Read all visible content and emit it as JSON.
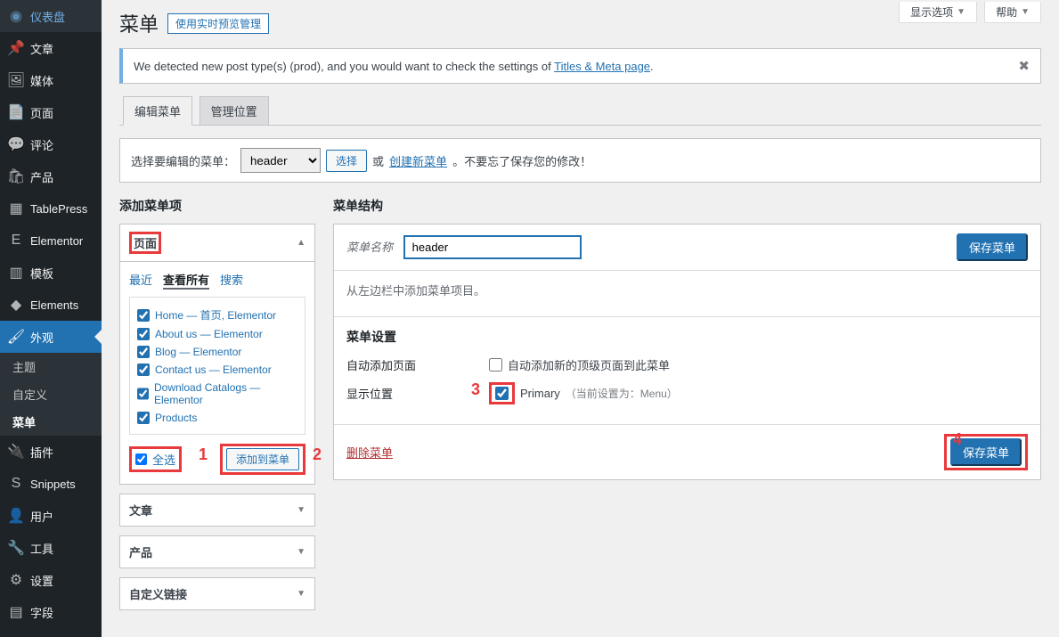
{
  "top_tabs": {
    "options": "显示选项",
    "help": "帮助"
  },
  "sidebar": {
    "items": [
      {
        "icon": "◉",
        "label": "仪表盘"
      },
      {
        "icon": "📌",
        "label": "文章"
      },
      {
        "icon": "🖼",
        "label": "媒体"
      },
      {
        "icon": "📄",
        "label": "页面"
      },
      {
        "icon": "💬",
        "label": "评论"
      },
      {
        "icon": "🛍",
        "label": "产品"
      },
      {
        "icon": "▦",
        "label": "TablePress"
      },
      {
        "icon": "E",
        "label": "Elementor"
      },
      {
        "icon": "▥",
        "label": "模板"
      },
      {
        "icon": "◆",
        "label": "Elements"
      },
      {
        "icon": "🖌",
        "label": "外观"
      },
      {
        "icon": "🔌",
        "label": "插件"
      },
      {
        "icon": "S",
        "label": "Snippets"
      },
      {
        "icon": "👤",
        "label": "用户"
      },
      {
        "icon": "🔧",
        "label": "工具"
      },
      {
        "icon": "⚙",
        "label": "设置"
      },
      {
        "icon": "▤",
        "label": "字段"
      }
    ],
    "submenu": [
      "主题",
      "自定义",
      "菜单"
    ]
  },
  "page": {
    "title": "菜单",
    "live_preview_btn": "使用实时预览管理",
    "notice_prefix": "We detected new post type(s) (prod), and you would want to check the settings of ",
    "notice_link": "Titles & Meta page",
    "tab_edit": "编辑菜单",
    "tab_locations": "管理位置",
    "select_label": "选择要编辑的菜单：",
    "select_value": "header",
    "select_btn": "选择",
    "or": "或",
    "create_new": "创建新菜单",
    "dont_forget": "。不要忘了保存您的修改！"
  },
  "add_items": {
    "heading": "添加菜单项",
    "acc_page": "页面",
    "inner_tabs": [
      "最近",
      "查看所有",
      "搜索"
    ],
    "pages": [
      "Home — 首页, Elementor",
      "About us — Elementor",
      "Blog — Elementor",
      "Contact us — Elementor",
      "Download Catalogs — Elementor",
      "Products"
    ],
    "select_all": "全选",
    "add_to_menu": "添加到菜单",
    "acc_posts": "文章",
    "acc_products": "产品",
    "acc_custom": "自定义链接"
  },
  "structure": {
    "heading": "菜单结构",
    "name_label": "菜单名称",
    "name_value": "header",
    "save_btn": "保存菜单",
    "mid_text": "从左边栏中添加菜单项目。",
    "settings_title": "菜单设置",
    "auto_add_label": "自动添加页面",
    "auto_add_text": "自动添加新的顶级页面到此菜单",
    "display_label": "显示位置",
    "primary": "Primary",
    "current_hint": "（当前设置为：Menu）",
    "delete": "删除菜单"
  },
  "annotations": {
    "n1": "1",
    "n2": "2",
    "n3": "3",
    "n4": "4"
  }
}
